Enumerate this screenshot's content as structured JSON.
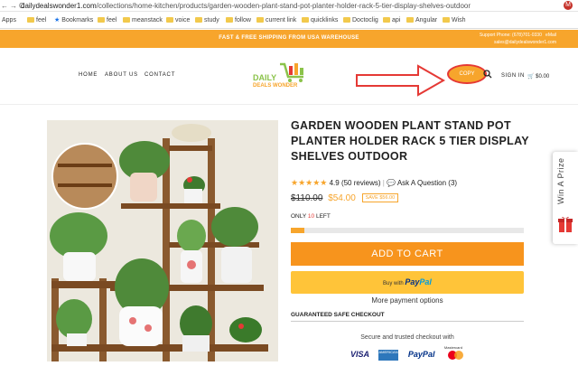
{
  "browser": {
    "url_host": "dailydealswonder1.com",
    "url_path": "/collections/home-kitchen/products/garden-wooden-plant-stand-pot-planter-holder-rack-5-tier-display-shelves-outdoor",
    "avatar_letter": "M",
    "bookmarks": [
      "Apps",
      "feel",
      "Bookmarks",
      "feel",
      "meanstack",
      "voice",
      "study",
      "follow",
      "current link",
      "quicklinks",
      "Doctoclig",
      "api",
      "Angular",
      "Wish"
    ]
  },
  "banner": {
    "message": "FAST & FREE SHIPPING FROM USA WAREHOUSE",
    "support_phone": "Support Phone: (678)701-0330",
    "support_email": "sales@dailydealswonder1.com",
    "email_label": "eMail"
  },
  "header": {
    "nav": [
      "HOME",
      "ABOUT US",
      "CONTACT"
    ],
    "logo_line1": "DAILY",
    "logo_line2": "DEALS WONDER",
    "copy_button": "COPY",
    "sign_in": "SIGN IN",
    "cart_total": "$0.00"
  },
  "product": {
    "title": "GARDEN WOODEN PLANT STAND POT PLANTER HOLDER RACK 5 TIER DISPLAY SHELVES OUTDOOR",
    "rating": "4.9",
    "rating_stars": 5,
    "reviews": "(50 reviews)",
    "ask_question": "Ask A Question (3)",
    "old_price": "$110.00",
    "new_price": "$54.00",
    "save_badge": "SAVE $56.00",
    "stock_prefix": "ONLY ",
    "stock_count": "10",
    "stock_suffix": " LEFT",
    "stock_level_fraction": 0.06,
    "add_to_cart": "ADD TO CART",
    "buy_with": "Buy with",
    "paypal_a": "Pay",
    "paypal_b": "Pal",
    "more_options": "More payment options",
    "guaranteed": "GUARANTEED SAFE CHECKOUT",
    "secure": "Secure and trusted checkout with",
    "payment_methods": [
      "VISA",
      "AMERICAN EXPRESS",
      "PayPal",
      "Mastercard"
    ]
  },
  "prize_tab": {
    "label": "Win A Prize"
  },
  "colors": {
    "accent": "#f7a52c",
    "cart_button": "#f7941d",
    "paypal_yellow": "#ffc439",
    "stock_red": "#e53935"
  },
  "icons": [
    "back-icon",
    "forward-icon",
    "reload-icon",
    "search-icon",
    "cart-icon",
    "gift-icon",
    "chat-icon",
    "star-icon"
  ]
}
